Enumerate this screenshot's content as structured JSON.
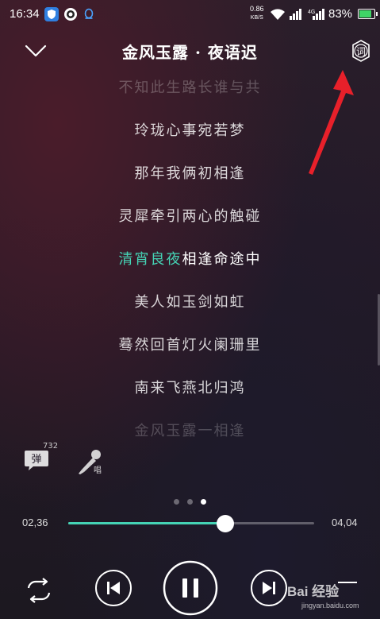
{
  "status_bar": {
    "time": "16:34",
    "net_speed_value": "0.86",
    "net_speed_unit": "KB/S",
    "battery_percent": "83%",
    "battery_level": 0.83
  },
  "header": {
    "title": "金风玉露 · 夜语迟",
    "lyric_settings_label": "词"
  },
  "lyrics": {
    "lines": [
      "不知此生路长谁与共",
      "玲珑心事宛若梦",
      "那年我俩初相逢",
      "灵犀牵引两心的触碰",
      "",
      "美人如玉剑如虹",
      "蓦然回首灯火阑珊里",
      "南来飞燕北归鸿",
      "金风玉露一相逢"
    ],
    "current_highlight": "清宵良夜",
    "current_rest": "相逢命途中"
  },
  "actions": {
    "danmu_label": "弹",
    "danmu_count": "732",
    "sing_label": "唱"
  },
  "pager": {
    "count": 3,
    "active_index": 2
  },
  "progress": {
    "elapsed": "02,36",
    "total": "04,04",
    "fraction": 0.64
  },
  "watermark": {
    "text": "Bai 经验",
    "sub": "jingyan.baidu.com"
  },
  "colors": {
    "accent": "#45d3b5",
    "annotation_arrow": "#e8202a"
  }
}
